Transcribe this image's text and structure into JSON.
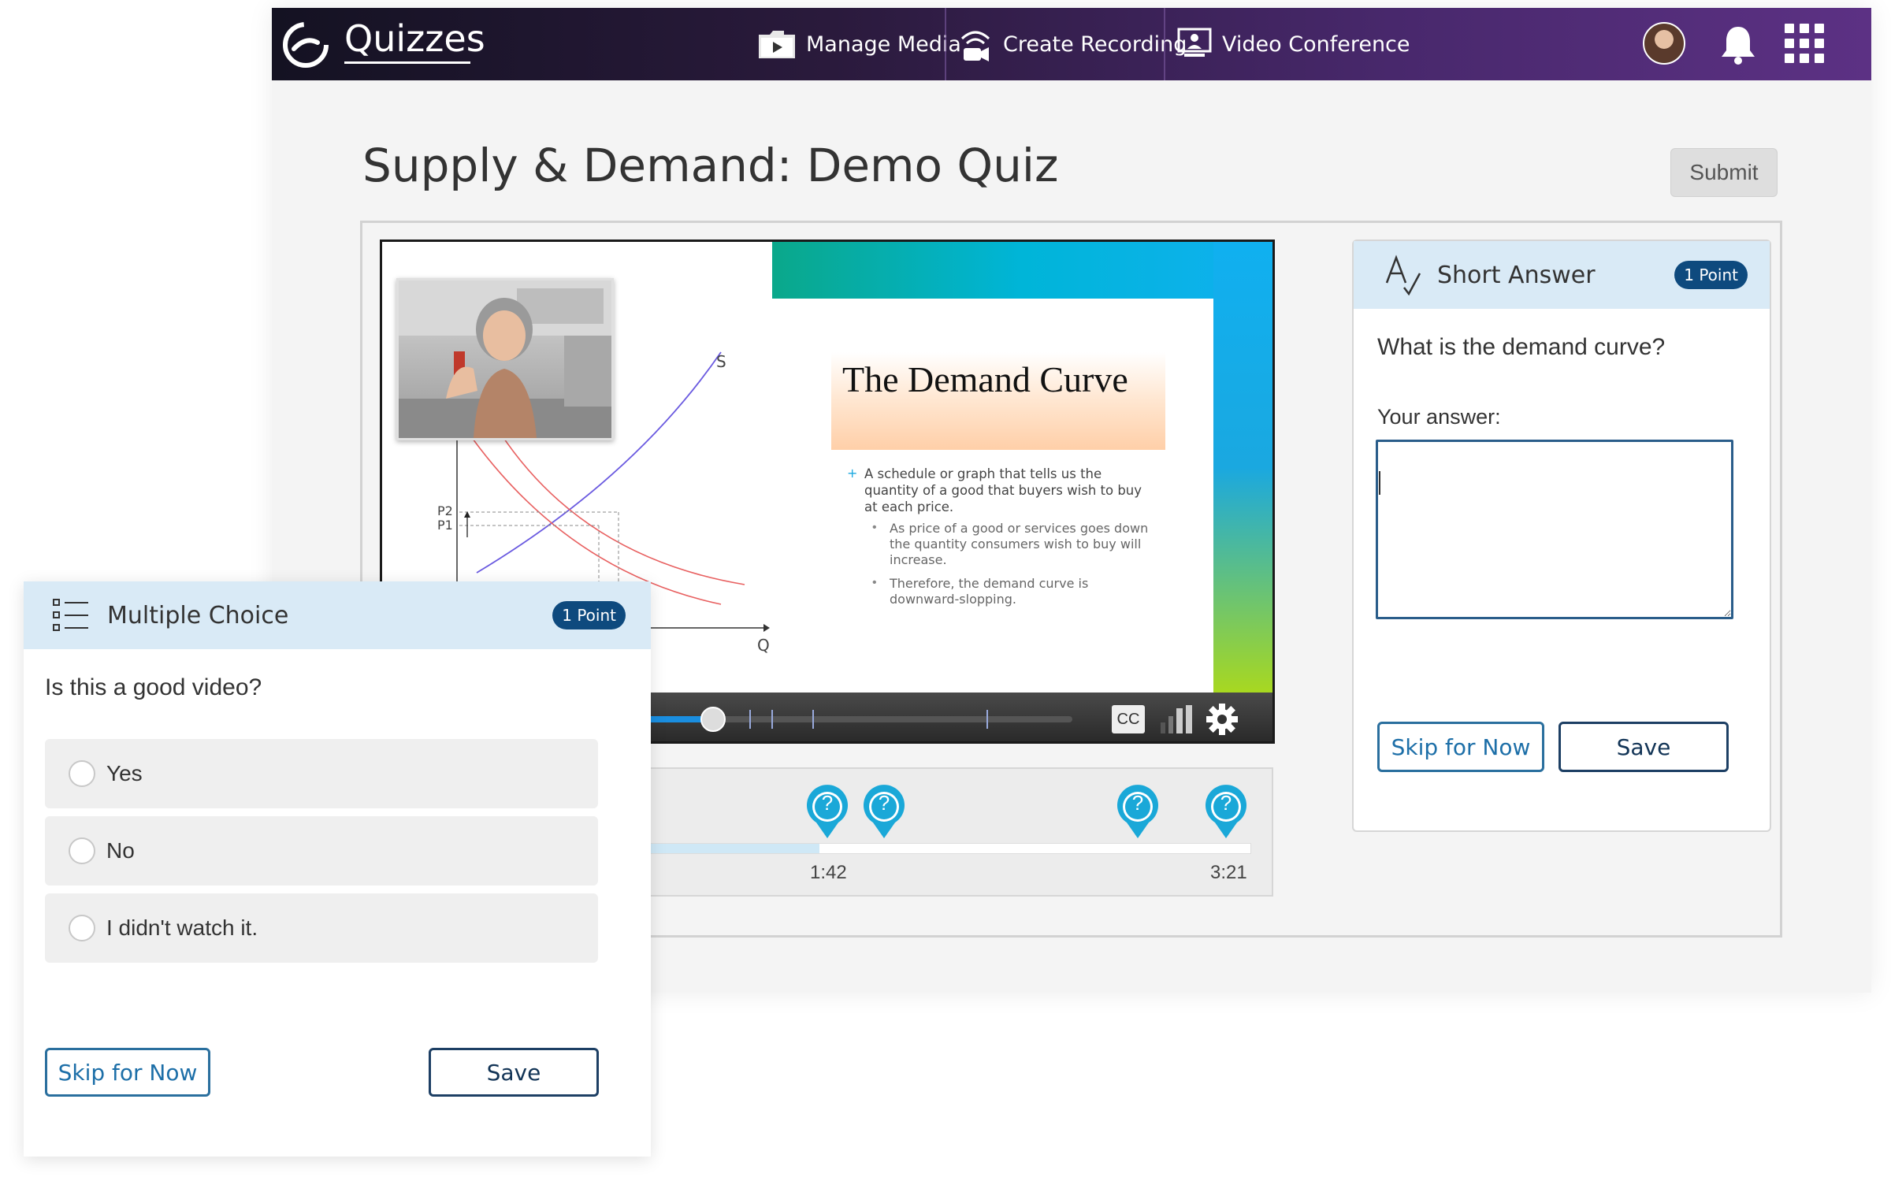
{
  "app": {
    "brand": "Quizzes",
    "nav": [
      {
        "label": "Manage Media",
        "icon": "media-folder-icon"
      },
      {
        "label": "Create Recording",
        "icon": "recording-icon"
      },
      {
        "label": "Video Conference",
        "icon": "video-conference-icon"
      }
    ],
    "icons": {
      "avatar": "user-avatar",
      "notifications": "bell-icon",
      "apps": "app-grid-icon"
    }
  },
  "page": {
    "title": "Supply & Demand: Demo Quiz",
    "submit_label": "Submit"
  },
  "video": {
    "slide": {
      "title": "The Demand Curve",
      "bullet_main": "A schedule or graph that tells us the quantity of a good that buyers wish to buy at each price.",
      "bullet_sub1": "As price of a good or services goes down the quantity consumers wish to buy will increase.",
      "bullet_sub2": "Therefore, the demand curve is downward-slopping.",
      "graph_labels": {
        "s": "S",
        "q": "Q",
        "p1": "P1",
        "p2": "P2"
      }
    },
    "controls": {
      "cc_label": "CC",
      "progress_fraction": 0.48
    }
  },
  "timeline": {
    "markers": [
      {
        "time_label": "1:42"
      },
      {
        "time_label": "3:21"
      }
    ],
    "pin_glyph": "?"
  },
  "short_answer": {
    "type_label": "Short Answer",
    "points": "1 Point",
    "question": "What is the demand curve?",
    "answer_label": "Your answer:",
    "answer_value": "",
    "skip_label": "Skip for Now",
    "save_label": "Save"
  },
  "multiple_choice": {
    "type_label": "Multiple Choice",
    "points": "1 Point",
    "question": "Is this a good video?",
    "options": [
      {
        "label": "Yes"
      },
      {
        "label": "No"
      },
      {
        "label": "I didn't watch it."
      }
    ],
    "skip_label": "Skip for Now",
    "save_label": "Save"
  }
}
